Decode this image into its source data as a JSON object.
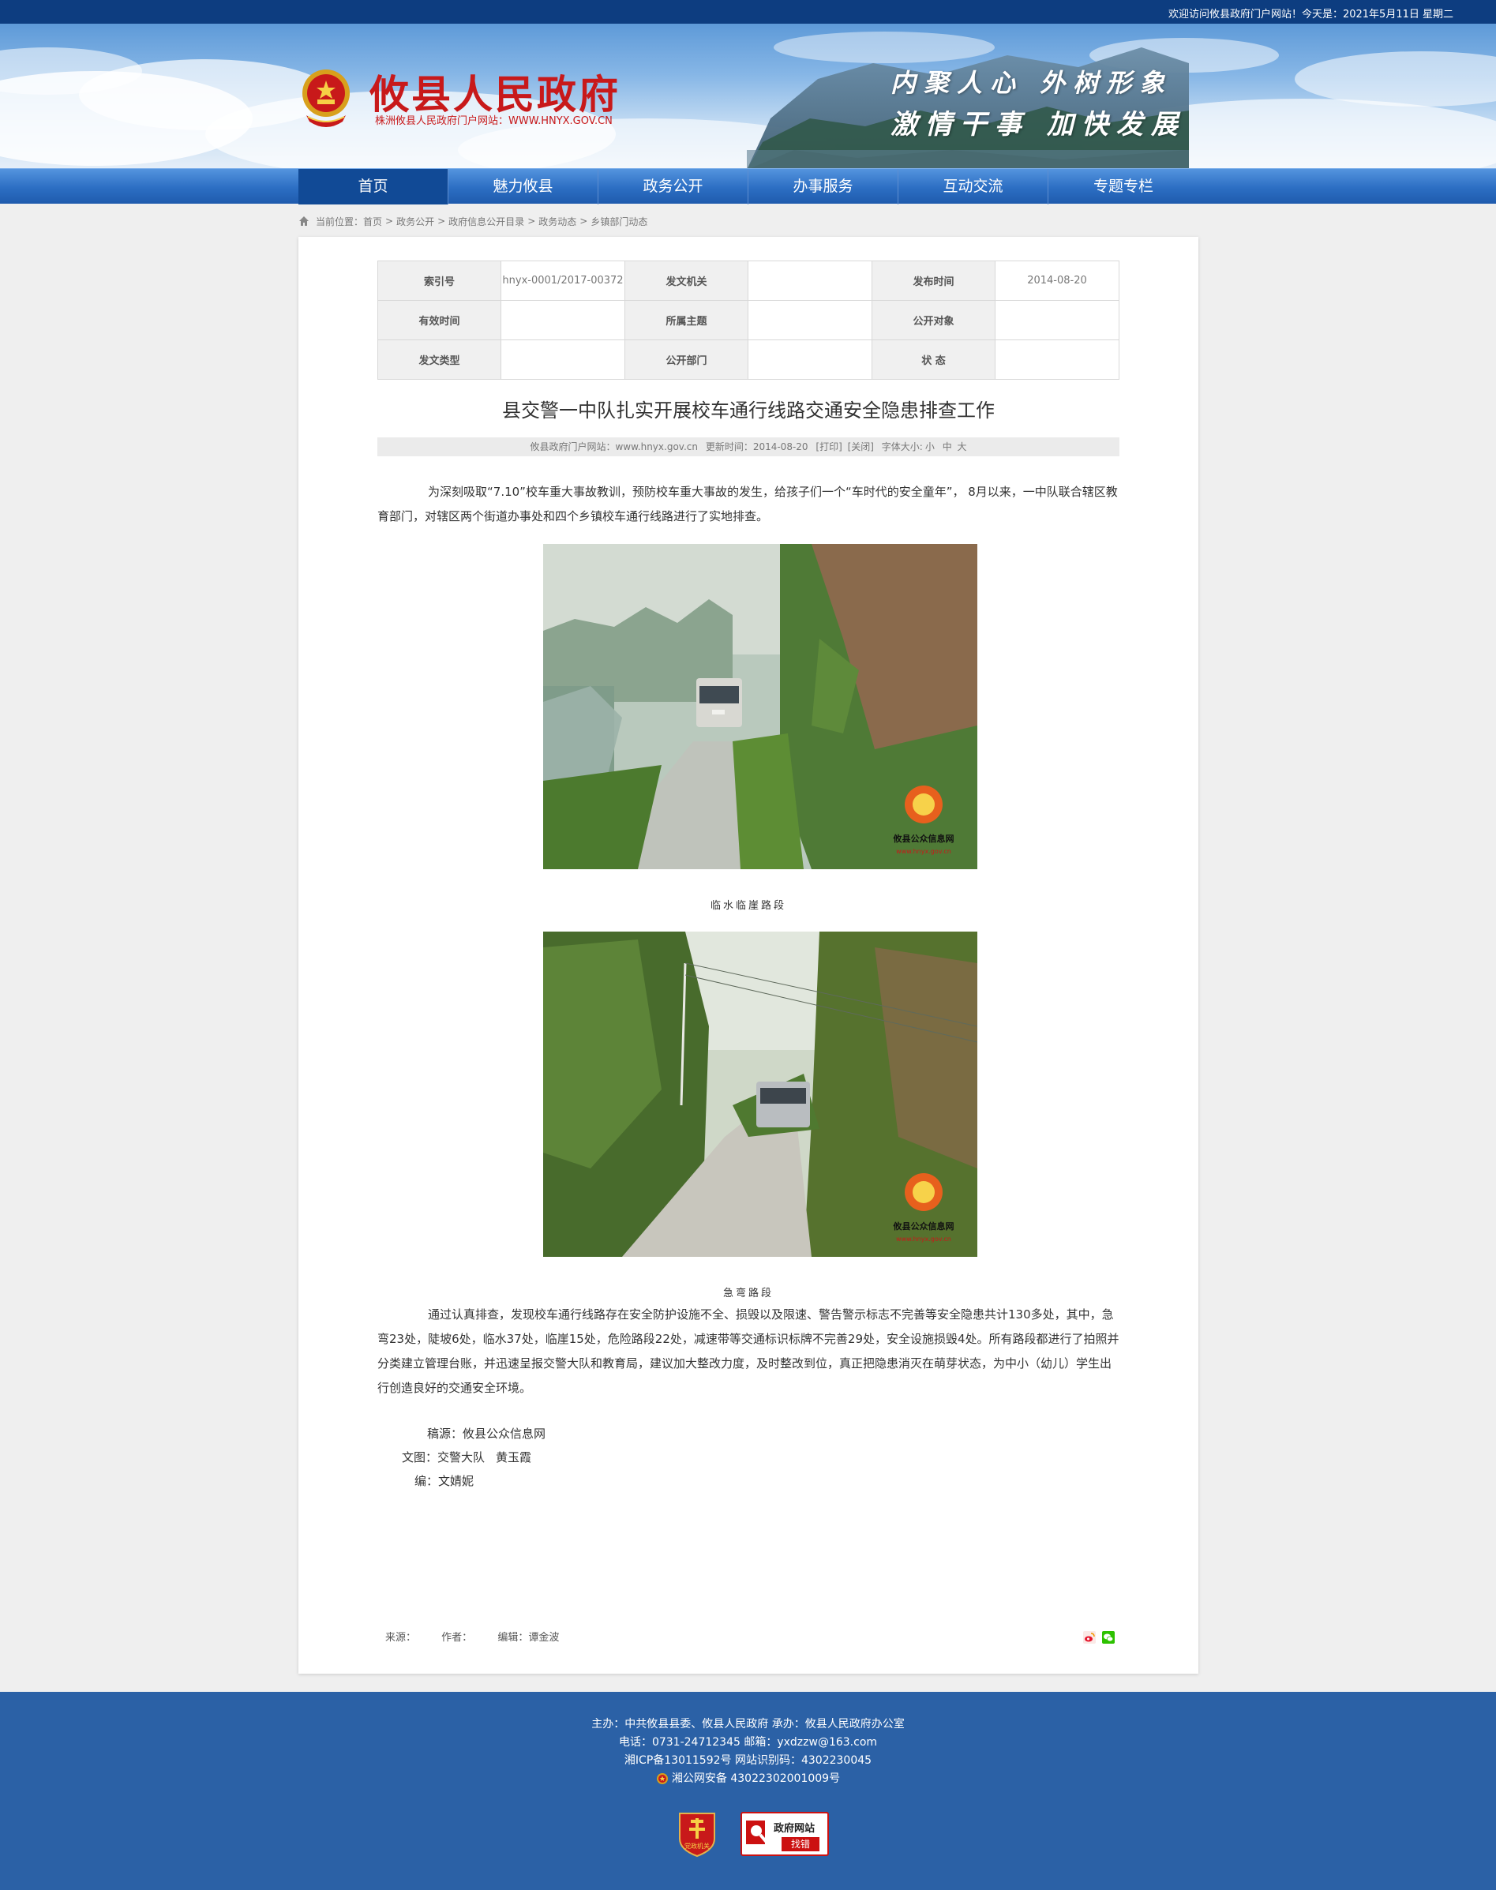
{
  "topbar": {
    "welcome": "欢迎访问攸县政府门户网站！今天是：2021年5月11日 星期二"
  },
  "header": {
    "site_title": "攸县人民政府",
    "site_sub": "株洲攸县人民政府门户网站：WWW.HNYX.GOV.CN",
    "slogan_line1": "内聚人心 外树形象",
    "slogan_line2": "激情干事 加快发展"
  },
  "nav": {
    "items": [
      {
        "label": "首页"
      },
      {
        "label": "魅力攸县"
      },
      {
        "label": "政务公开"
      },
      {
        "label": "办事服务"
      },
      {
        "label": "互动交流"
      },
      {
        "label": "专题专栏"
      }
    ]
  },
  "breadcrumb": {
    "prefix": "当前位置：",
    "items": [
      "首页",
      "政务公开",
      "政府信息公开目录",
      "政务动态",
      "乡镇部门动态"
    ]
  },
  "meta_table": {
    "rows": [
      [
        {
          "key": "索引号",
          "value": "hnyx-0001/2017-00372"
        },
        {
          "key": "发文机关",
          "value": ""
        },
        {
          "key": "发布时间",
          "value": "2014-08-20"
        }
      ],
      [
        {
          "key": "有效时间",
          "value": ""
        },
        {
          "key": "所属主题",
          "value": ""
        },
        {
          "key": "公开对象",
          "value": ""
        }
      ],
      [
        {
          "key": "发文类型",
          "value": ""
        },
        {
          "key": "公开部门",
          "value": ""
        },
        {
          "key": "状 态",
          "value": ""
        }
      ]
    ]
  },
  "article": {
    "title": "县交警一中队扎实开展校车通行线路交通安全隐患排查工作",
    "info": {
      "site": "攸县政府门户网站：www.hnyx.gov.cn",
      "updated": "更新时间：2014-08-20",
      "print": "[打印]",
      "close": "[关闭]",
      "font_label": "字体大小:",
      "font_small": "小",
      "font_medium": "中",
      "font_large": "大"
    },
    "para1": "为深刻吸取“7.10”校车重大事故教训，预防校车重大事故的发生，给孩子们一个“车时代的安全童年”，  8月以来，一中队联合辖区教育部门，对辖区两个街道办事处和四个乡镇校车通行线路进行了实地排查。",
    "caption1": "临水临崖路段",
    "caption2": "急弯路段",
    "watermark": "攸县公众信息网",
    "watermark_url": "www.hnyx.gov.cn",
    "para2": "通过认真排查，发现校车通行线路存在安全防护设施不全、损毁以及限速、警告警示标志不完善等安全隐患共计130多处，其中，急弯23处，陡坡6处，临水37处，临崖15处，危险路段22处，减速带等交通标识标牌不完善29处，安全设施损毁4处。所有路段都进行了拍照并分类建立管理台账，并迅速呈报交警大队和教育局，建议加大整改力度，及时整改到位，真正把隐患消灭在萌芽状态，为中小（幼儿）学生出行创造良好的交通安全环境。",
    "credit_source": "稿源：攸县公众信息网",
    "credit_text_label": "文图：交警大队",
    "credit_text_name": "黄玉霞",
    "credit_editor": "编：文婧妮"
  },
  "article_footer": {
    "source": "来源：",
    "author": "作者：",
    "editor": "编辑：谭金波"
  },
  "footer": {
    "line1": "主办：中共攸县县委、攸县人民政府 承办：攸县人民政府办公室",
    "line2": "电话：0731-24712345 邮箱：yxdzzw@163.com",
    "line3": "湘ICP备13011592号    网站识别码：4302230045",
    "line4": "湘公网安备 43022302001009号",
    "logo1_text": "党政机关",
    "logo2_title": "政府网站",
    "logo2_sub": "找错"
  },
  "colors": {
    "topbar": "#0d3d80",
    "nav": "#2c6ec3",
    "nav_active": "#114a96",
    "title_red": "#c8191a",
    "footer": "#2b61a6"
  }
}
